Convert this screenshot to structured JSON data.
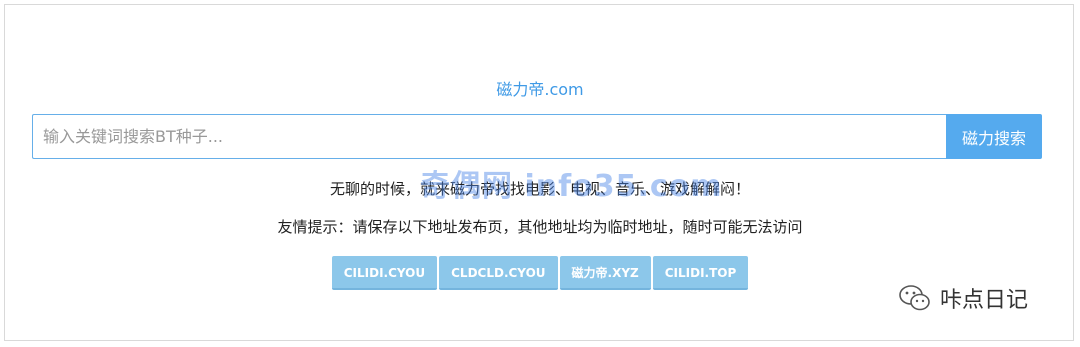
{
  "site": {
    "logo": "磁力帝.com"
  },
  "search": {
    "placeholder": "输入关键词搜索BT种子...",
    "button_label": "磁力搜索"
  },
  "slogan": "无聊的时候，就来磁力帝找找电影、电视、音乐、游戏解解闷！",
  "notice": "友情提示：请保存以下地址发布页，其他地址均为临时地址，随时可能无法访问",
  "mirrors": [
    "CILIDI.CYOU",
    "CLDCLD.CYOU",
    "磁力帝.XYZ",
    "CILIDI.TOP"
  ],
  "watermark": "奇偶网 info35.com",
  "wechat": {
    "name": "咔点日记",
    "icon": "wechat-icon"
  },
  "colors": {
    "accent": "#55aaee",
    "logo": "#3f9ae6",
    "mirror_button": "#8cc7ea"
  }
}
